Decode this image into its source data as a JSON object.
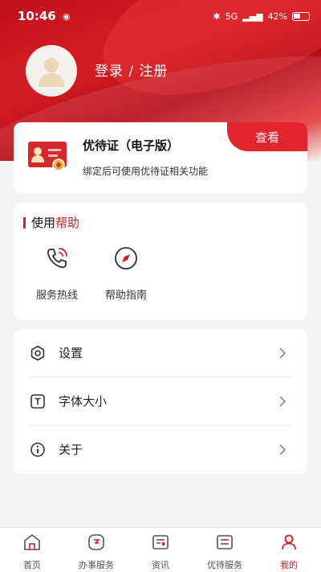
{
  "status_bar": {
    "time": "10:46",
    "nfc_icon": "nfc-icon",
    "network_text": "5G",
    "battery": "42%"
  },
  "profile": {
    "login_label": "登录 / 注册"
  },
  "cert_card": {
    "title": "优待证（电子版）",
    "description": "绑定后可使用优待证相关功能",
    "view_button": "查看"
  },
  "help": {
    "header_prefix": "使用",
    "header_accent": "帮助",
    "items": [
      {
        "label": "服务热线",
        "icon": "phone-icon"
      },
      {
        "label": "帮助指南",
        "icon": "compass-icon"
      }
    ]
  },
  "settings": {
    "items": [
      {
        "label": "设置",
        "icon": "gear-icon"
      },
      {
        "label": "字体大小",
        "icon": "font-size-icon"
      },
      {
        "label": "关于",
        "icon": "info-icon"
      }
    ]
  },
  "bottom_nav": {
    "items": [
      {
        "label": "首页",
        "icon": "home-icon"
      },
      {
        "label": "办事服务",
        "icon": "service-icon"
      },
      {
        "label": "资讯",
        "icon": "news-icon"
      },
      {
        "label": "优待服务",
        "icon": "benefit-icon"
      },
      {
        "label": "我的",
        "icon": "profile-icon"
      }
    ],
    "active_index": 4
  },
  "colors": {
    "accent": "#d21f27",
    "button": "#e2262e"
  }
}
